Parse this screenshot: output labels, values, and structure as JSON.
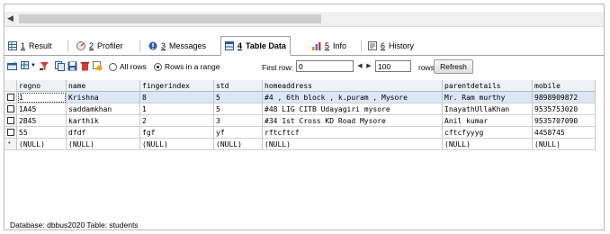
{
  "tabs": [
    {
      "num": "1",
      "label": "Result",
      "icon": "result-grid-icon"
    },
    {
      "num": "2",
      "label": "Profiler",
      "icon": "profiler-icon"
    },
    {
      "num": "3",
      "label": "Messages",
      "icon": "messages-icon"
    },
    {
      "num": "4",
      "label": "Table Data",
      "icon": "table-data-icon",
      "active": true
    },
    {
      "num": "5",
      "label": "Info",
      "icon": "info-icon"
    },
    {
      "num": "6",
      "label": "History",
      "icon": "history-icon"
    }
  ],
  "toolbar": {
    "all_rows_label": "All rows",
    "rows_in_range_label": "Rows in a range",
    "first_row_label": "First row:",
    "first_row_value": "0",
    "limit_value": "100",
    "rows_label": "rows",
    "refresh_label": "Refresh"
  },
  "grid": {
    "columns": [
      "regno",
      "name",
      "fingerindex",
      "std",
      "homeaddress",
      "parentdetails",
      "mobile"
    ],
    "rows": [
      [
        "1",
        "Krishna",
        "8",
        "5",
        "#4 , 6th block , k.puram , Mysore",
        "Mr. Ram murthy",
        "9898909872"
      ],
      [
        "1A45",
        "saddamkhan",
        "1",
        "5",
        "#48 LIG CITB Udayagiri mysore",
        "InayathUllaKhan",
        "9535753020"
      ],
      [
        "2B45",
        "karthik",
        "2",
        "3",
        "#34 1st Cross KD Road Mysore",
        "Anil kumar",
        "9535707090"
      ],
      [
        "55",
        "dfdf",
        "fgf",
        "yf",
        "rftcftcf",
        "cftcfyyyg",
        "4458745"
      ],
      [
        "(NULL)",
        "(NULL)",
        "(NULL)",
        "(NULL)",
        "(NULL)",
        "(NULL)",
        "(NULL)"
      ]
    ]
  },
  "status": "Database: dbbus2020 Table: students"
}
